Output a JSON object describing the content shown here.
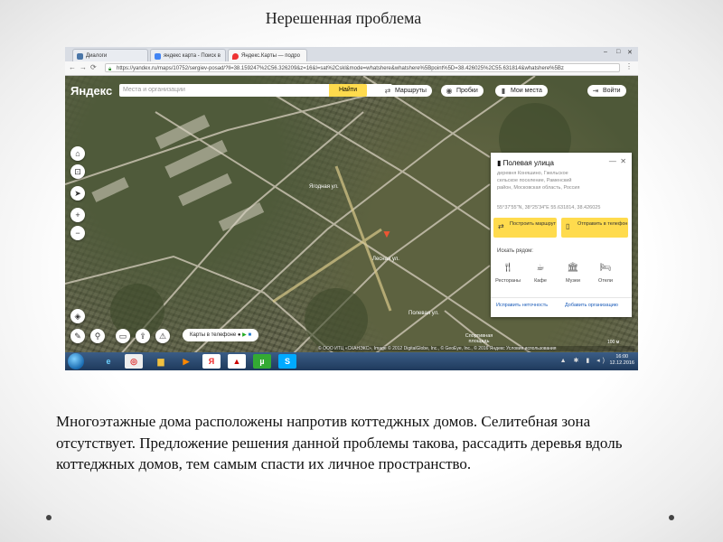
{
  "slide": {
    "title": "Нерешенная проблема",
    "body": "Многоэтажные дома расположены напротив коттеджных домов. Селитебная зона отсутствует. Предложение решения данной проблемы такова, рассадить деревья вдоль коттеджных домов, тем самым спасти их личное пространство."
  },
  "browser": {
    "tabs": [
      {
        "label": "Диалоги",
        "icon": "vk-icon"
      },
      {
        "label": "яндекс карта - Поиск в",
        "icon": "google-icon"
      },
      {
        "label": "Яндекс.Карты — подро",
        "icon": "map-pin-icon",
        "active": true
      }
    ],
    "url": "https://yandex.ru/maps/10752/sergiev-posad/?ll=38.159247%2C56.326209&z=16&l=sat%2Cskl&mode=whatshere&whatshere%5Bpoint%5D=38.426025%2C55.631814&whatshere%5Bz"
  },
  "map": {
    "logo": "Яндекс",
    "search_placeholder": "Места и организации",
    "search_button": "Найти",
    "routes_label": "Маршруты",
    "traffic_label": "Пробки",
    "my_places_label": "Мои места",
    "login_label": "Войти",
    "phone_button": "Карты в телефоне",
    "attribution": "© ООО ИТЦ «СКАНЭКС», Image © 2012 DigitalGlobe, Inc., © GeoEye, Inc., © 2016 Яндекс Условия использования",
    "scale": "100 м",
    "place_labels": [
      "Ягодная ул.",
      "Лесная ул.",
      "Полевая ул.",
      "Спортивная площадь"
    ]
  },
  "card": {
    "title": "Полевая улица",
    "address": "деревня Коняшино, Гжельское сельское поселение, Раменский район, Московская область, Россия",
    "coords": "55°37'55\"N, 38°25'34\"E   55.631814, 38.426025",
    "route_btn": "Построить маршрут",
    "send_btn": "Отправить в телефон",
    "nearby_title": "Искать рядом:",
    "nearby": [
      {
        "label": "Рестораны",
        "icon": "fork-knife-icon"
      },
      {
        "label": "Кафе",
        "icon": "cup-icon"
      },
      {
        "label": "Музеи",
        "icon": "museum-icon"
      },
      {
        "label": "Отели",
        "icon": "bed-icon"
      }
    ],
    "fix_link": "Исправить неточность",
    "add_org_link": "Добавить организацию"
  },
  "taskbar": {
    "time": "16:00",
    "date": "12.12.2016"
  },
  "colors": {
    "yandex_yellow": "#ffdb4d",
    "road": "#c8c2b0",
    "taskbar": "#2a4a70"
  }
}
